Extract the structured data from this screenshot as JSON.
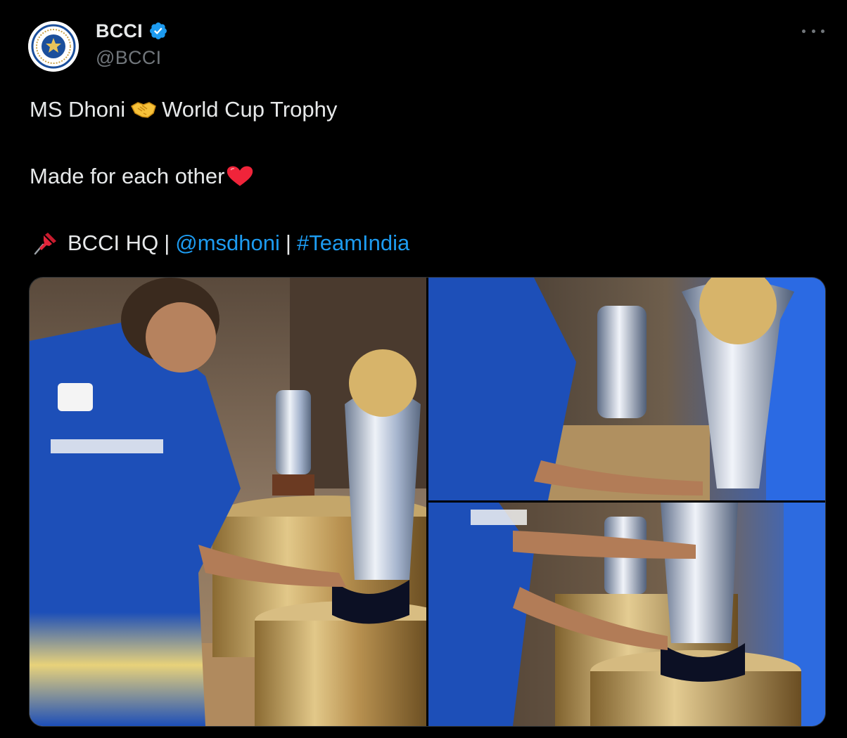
{
  "author": {
    "display_name": "BCCI",
    "handle": "@BCCI",
    "verified": true,
    "avatar_icon": "bcci-crest-icon"
  },
  "tweet": {
    "line1_before": "MS Dhoni",
    "line1_emoji": "handshake-emoji",
    "line1_after": "World Cup Trophy",
    "line2_text": "Made for each other",
    "line2_emoji": "red-heart-emoji",
    "line3_emoji": "pushpin-emoji",
    "line3_text": "BCCI HQ",
    "separator": "|",
    "mention": "@msdhoni",
    "hashtag": "#TeamIndia"
  },
  "media": {
    "photo_count": 3
  },
  "colors": {
    "background": "#000000",
    "text": "#e7e9ea",
    "secondary": "#71767b",
    "link": "#1d9bf0",
    "verified": "#1d9bf0"
  }
}
